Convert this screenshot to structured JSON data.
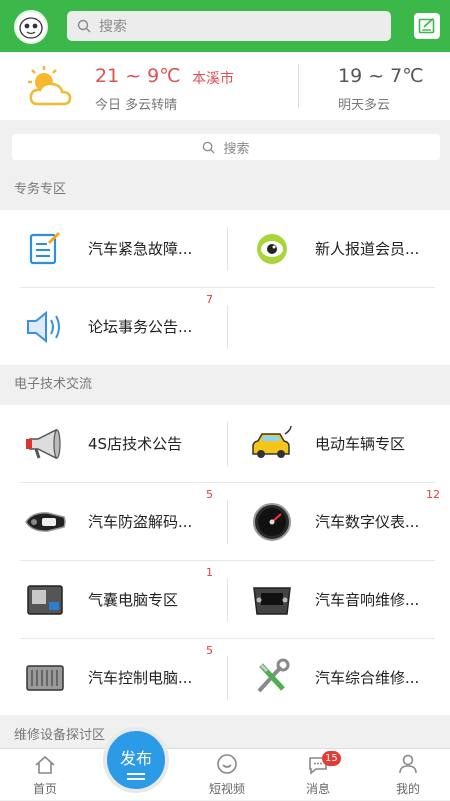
{
  "header": {
    "search_placeholder": "搜索",
    "avatar_icon": "cartoon-face-icon",
    "edit_icon": "edit-note-icon",
    "color": "#3cb84a"
  },
  "weather": {
    "today_temp": "21 ~ 9℃",
    "city": "本溪市",
    "today_desc": "今日 多云转晴",
    "tomorrow_temp": "19 ~ 7℃",
    "tomorrow_desc": "明天多云",
    "icon": "partly-cloudy-icon"
  },
  "search2": {
    "placeholder": "搜索"
  },
  "sections": [
    {
      "title": "专务专区",
      "items": [
        {
          "label": "汽车紧急故障...",
          "icon": "document-edit-icon",
          "badge": ""
        },
        {
          "label": "新人报道会员...",
          "icon": "eye-icon",
          "badge": ""
        },
        {
          "label": "论坛事务公告...",
          "icon": "speaker-icon",
          "badge": "7"
        }
      ]
    },
    {
      "title": "电子技术交流",
      "items": [
        {
          "label": "4S店技术公告",
          "icon": "megaphone-icon",
          "badge": ""
        },
        {
          "label": "电动车辆专区",
          "icon": "electric-car-icon",
          "badge": ""
        },
        {
          "label": "汽车防盗解码...",
          "icon": "car-key-icon",
          "badge": "5"
        },
        {
          "label": "汽车数字仪表...",
          "icon": "dashboard-gauge-icon",
          "badge": "12"
        },
        {
          "label": "气囊电脑专区",
          "icon": "airbag-module-icon",
          "badge": "1"
        },
        {
          "label": "汽车音响维修...",
          "icon": "car-stereo-icon",
          "badge": ""
        },
        {
          "label": "汽车控制电脑...",
          "icon": "ecu-module-icon",
          "badge": "5"
        },
        {
          "label": "汽车综合维修...",
          "icon": "tools-icon",
          "badge": ""
        }
      ]
    },
    {
      "title": "维修设备探讨区"
    }
  ],
  "bottom_nav": {
    "home": "首页",
    "publish": "发布",
    "video": "短视频",
    "messages": "消息",
    "messages_badge": "15",
    "mine": "我的",
    "accent": "#2b9be8"
  }
}
